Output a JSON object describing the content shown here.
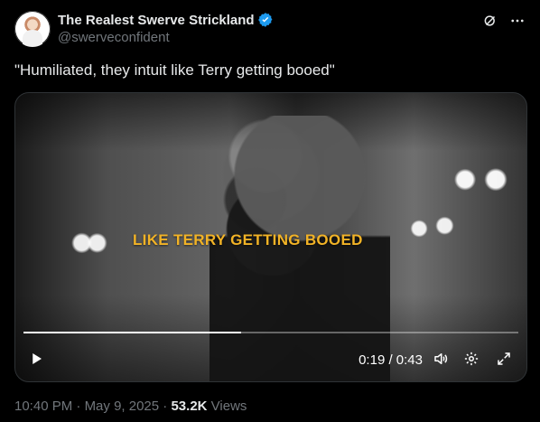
{
  "author": {
    "display_name": "The Realest Swerve Strickland",
    "handle": "@swerveconfident"
  },
  "tweet": {
    "text": "\"Humiliated, they intuit like Terry getting booed\""
  },
  "media": {
    "caption": "LIKE TERRY GETTING BOOED",
    "progress_fraction": 0.44,
    "time_label": "0:19 / 0:43"
  },
  "meta": {
    "time": "10:40 PM",
    "separator": "·",
    "date": "May 9, 2025",
    "views_count": "53.2K",
    "views_label": "Views"
  },
  "icons": {
    "verified": "verified-badge-icon",
    "grok": "grok-icon",
    "more": "more-icon",
    "play": "play-icon",
    "volume": "volume-icon",
    "settings": "gear-icon",
    "expand": "expand-icon"
  },
  "colors": {
    "background": "#000000",
    "text_primary": "#e7e9ea",
    "text_secondary": "#71767b",
    "verified_blue": "#1d9bf0",
    "caption_yellow": "#f2b326"
  }
}
